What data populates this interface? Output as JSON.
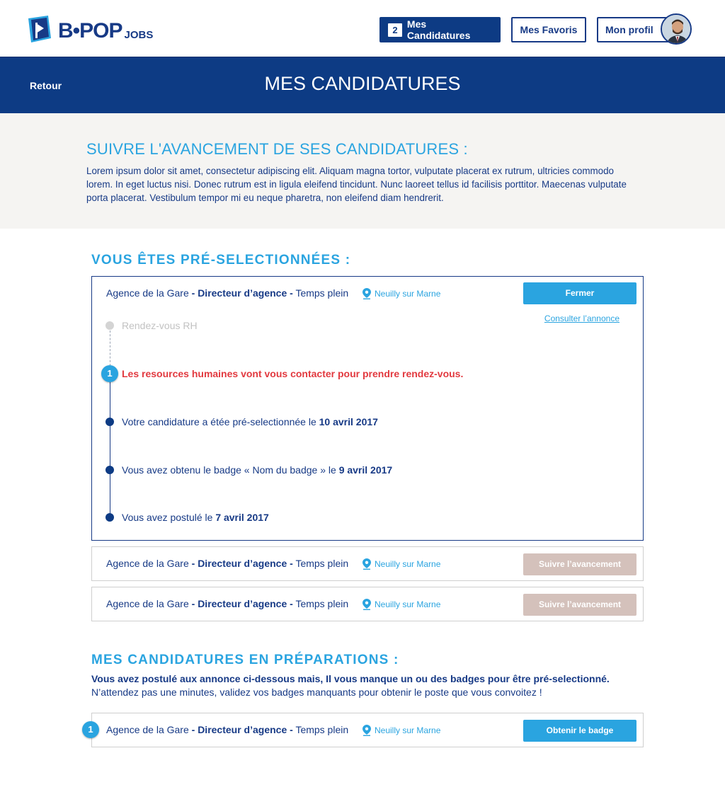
{
  "header": {
    "logo_text": "B•POP",
    "logo_sub": "JOBS",
    "nav": {
      "applications_count": "2",
      "applications_label": "Mes Candidatures",
      "favorites_label": "Mes Favoris",
      "profile_label": "Mon profil"
    }
  },
  "banner": {
    "back_label": "Retour",
    "title": "MES CANDIDATURES"
  },
  "intro": {
    "title": "SUIVRE L'AVANCEMENT DE SES CANDIDATURES :",
    "text": "Lorem ipsum dolor sit amet, consectetur adipiscing elit. Aliquam magna tortor, vulputate placerat ex rutrum, ultricies commodo lorem. In eget luctus nisi. Donec rutrum est in ligula eleifend tincidunt. Nunc laoreet tellus id facilisis porttitor. Maecenas vulputate porta placerat. Vestibulum tempor mi eu neque pharetra, non eleifend diam hendrerit."
  },
  "preselected": {
    "title": "VOUS ÊTES PRÉ-SELECTIONNÉES :",
    "expanded_card": {
      "agency": "Agence de la Gare",
      "position": "- Directeur d’agence -",
      "contract": "Temps plein",
      "location": "Neuilly sur Marne",
      "button": "Fermer",
      "consult_link": "Consulter l’annonce",
      "timeline": {
        "step_future": "Rendez-vous RH",
        "current_number": "1",
        "current_text": "Les resources humaines vont vous contacter pour prendre rendez-vous.",
        "step3_text": "Votre candidature a étée pré-selectionnée le",
        "step3_date": "10 avril 2017",
        "step2_text": "Vous avez obtenu le badge « Nom du badge » le",
        "step2_date": "9 avril 2017",
        "step1_text": "Vous avez postulé le",
        "step1_date": "7 avril 2017"
      }
    },
    "cards": [
      {
        "agency": "Agence de la Gare",
        "position": "- Directeur d’agence -",
        "contract": "Temps plein",
        "location": "Neuilly sur Marne",
        "button": "Suivre l’avancement"
      },
      {
        "agency": "Agence de la Gare",
        "position": "- Directeur d’agence -",
        "contract": "Temps plein",
        "location": "Neuilly sur Marne",
        "button": "Suivre l’avancement"
      }
    ]
  },
  "preparation": {
    "title": "MES CANDIDATURES EN PRÉPARATIONS :",
    "text_strong": "Vous avez postulé aux annonce ci-dessous mais, Il vous manque un ou des badges pour être pré-selectionné.",
    "text": "N’attendez pas une minutes, validez vos badges manquants pour obtenir le poste que vous convoitez !",
    "cards": [
      {
        "badge_number": "1",
        "agency": "Agence de la Gare",
        "position": "- Directeur d’agence -",
        "contract": "Temps plein",
        "location": "Neuilly sur Marne",
        "button": "Obtenir le badge"
      }
    ]
  },
  "colors": {
    "navy": "#0d3b84",
    "accent_blue": "#2aa4e0",
    "alert_red": "#e2393f",
    "beige_button": "#d4c1bb",
    "intro_bg": "#f5f4f2"
  },
  "icons": [
    "logo-mark-icon",
    "location-pin-icon",
    "avatar"
  ]
}
